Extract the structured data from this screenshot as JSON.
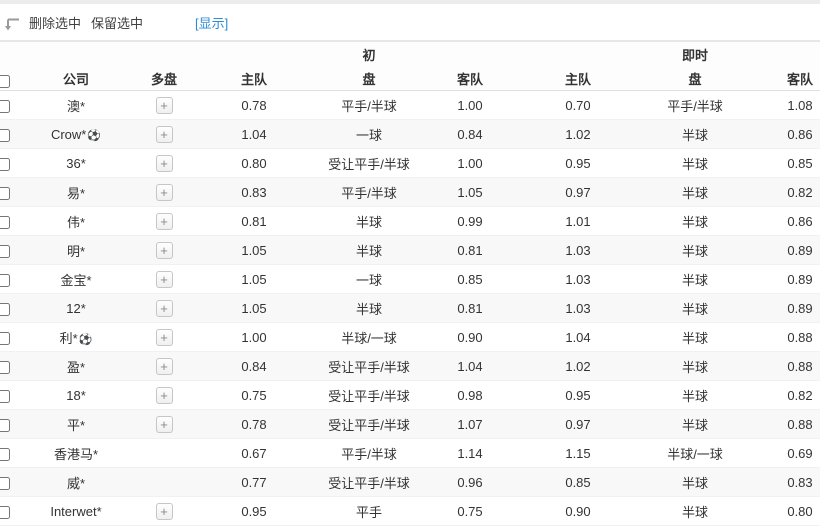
{
  "toolbar": {
    "delete_label": "删除选中",
    "keep_label": "保留选中",
    "show_link": "[显示]"
  },
  "header": {
    "company": "公司",
    "multi": "多盘",
    "initial_group": "初",
    "live_group": "即时",
    "home": "主队",
    "handicap": "盘",
    "away": "客队"
  },
  "colors": {
    "link_blue": "#2b8bd3",
    "alt_row": "#f8f8f8",
    "text": "#333333"
  },
  "table": {
    "rows": [
      {
        "company": "澳*",
        "ball": false,
        "multi": true,
        "init_home": "0.78",
        "init_handicap": "平手/半球",
        "init_away": "1.00",
        "live_home": "0.70",
        "live_handicap": "平手/半球",
        "live_away": "1.08"
      },
      {
        "company": "Crow*",
        "ball": true,
        "multi": true,
        "init_home": "1.04",
        "init_handicap": "一球",
        "init_away": "0.84",
        "live_home": "1.02",
        "live_handicap": "半球",
        "live_away": "0.86"
      },
      {
        "company": "36*",
        "ball": false,
        "multi": true,
        "init_home": "0.80",
        "init_handicap": "受让平手/半球",
        "init_away": "1.00",
        "live_home": "0.95",
        "live_handicap": "半球",
        "live_away": "0.85"
      },
      {
        "company": "易*",
        "ball": false,
        "multi": true,
        "init_home": "0.83",
        "init_handicap": "平手/半球",
        "init_away": "1.05",
        "live_home": "0.97",
        "live_handicap": "半球",
        "live_away": "0.82"
      },
      {
        "company": "伟*",
        "ball": false,
        "multi": true,
        "init_home": "0.81",
        "init_handicap": "半球",
        "init_away": "0.99",
        "live_home": "1.01",
        "live_handicap": "半球",
        "live_away": "0.86"
      },
      {
        "company": "明*",
        "ball": false,
        "multi": true,
        "init_home": "1.05",
        "init_handicap": "半球",
        "init_away": "0.81",
        "live_home": "1.03",
        "live_handicap": "半球",
        "live_away": "0.89"
      },
      {
        "company": "金宝*",
        "ball": false,
        "multi": true,
        "init_home": "1.05",
        "init_handicap": "一球",
        "init_away": "0.85",
        "live_home": "1.03",
        "live_handicap": "半球",
        "live_away": "0.89"
      },
      {
        "company": "12*",
        "ball": false,
        "multi": true,
        "init_home": "1.05",
        "init_handicap": "半球",
        "init_away": "0.81",
        "live_home": "1.03",
        "live_handicap": "半球",
        "live_away": "0.89"
      },
      {
        "company": "利*",
        "ball": true,
        "multi": true,
        "init_home": "1.00",
        "init_handicap": "半球/一球",
        "init_away": "0.90",
        "live_home": "1.04",
        "live_handicap": "半球",
        "live_away": "0.88"
      },
      {
        "company": "盈*",
        "ball": false,
        "multi": true,
        "init_home": "0.84",
        "init_handicap": "受让平手/半球",
        "init_away": "1.04",
        "live_home": "1.02",
        "live_handicap": "半球",
        "live_away": "0.88"
      },
      {
        "company": "18*",
        "ball": false,
        "multi": true,
        "init_home": "0.75",
        "init_handicap": "受让平手/半球",
        "init_away": "0.98",
        "live_home": "0.95",
        "live_handicap": "半球",
        "live_away": "0.82"
      },
      {
        "company": "平*",
        "ball": false,
        "multi": true,
        "init_home": "0.78",
        "init_handicap": "受让平手/半球",
        "init_away": "1.07",
        "live_home": "0.97",
        "live_handicap": "半球",
        "live_away": "0.88"
      },
      {
        "company": "香港马*",
        "ball": false,
        "multi": false,
        "init_home": "0.67",
        "init_handicap": "平手/半球",
        "init_away": "1.14",
        "live_home": "1.15",
        "live_handicap": "半球/一球",
        "live_away": "0.69"
      },
      {
        "company": "威*",
        "ball": false,
        "multi": false,
        "init_home": "0.77",
        "init_handicap": "受让平手/半球",
        "init_away": "0.96",
        "live_home": "0.85",
        "live_handicap": "半球",
        "live_away": "0.83"
      },
      {
        "company": "Interwet*",
        "ball": false,
        "multi": true,
        "init_home": "0.95",
        "init_handicap": "平手",
        "init_away": "0.75",
        "live_home": "0.90",
        "live_handicap": "半球",
        "live_away": "0.80"
      }
    ]
  }
}
